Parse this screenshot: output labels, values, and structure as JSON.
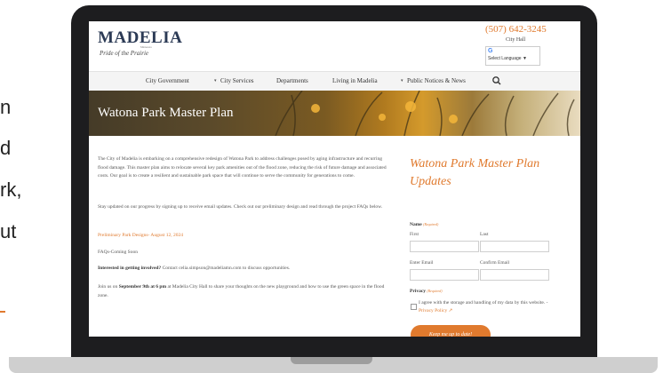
{
  "external_text": {
    "lines": [
      "n",
      "d",
      "rk,",
      "ut"
    ]
  },
  "site": {
    "logo": "MADELIA",
    "logo_sub": "Minnesota",
    "tagline": "Pride of the Prairie",
    "phone": "(507) 642-3245",
    "city_hall": "City Hall",
    "translate_label": "Select Language",
    "translate_caret": "▼",
    "google_g": "G"
  },
  "nav": {
    "items": [
      "City Government",
      "City Services",
      "Departments",
      "Living in Madelia",
      "Public Notices & News"
    ],
    "caret": "▾"
  },
  "hero": {
    "title": "Watona Park Master Plan"
  },
  "content": {
    "intro": "The City of Madelia is embarking on a comprehensive redesign of Watona Park to address challenges posed by aging infrastructure and recurring flood damage. This master plan aims to relocate several key park amenities out of the flood zone, reducing the risk of future damage and associated costs. Our goal is to create a resilient and sustainable park space that will continue to serve the community for generations to come.",
    "stay_updated": "Stay updated on our progress by signing up to receive email updates. Check out our preliminary design and read through the project FAQs below.",
    "prelim_link": "Preliminary Park Designs- August 12, 2024",
    "faqs": "FAQs-Coming Soon",
    "interested_bold": "Interested in getting involved?",
    "interested_rest": " Contact celia.simpson@madeliamn.com to discuss opportunities.",
    "join_pre": "Join us on ",
    "join_bold": "September 9th at 6 pm",
    "join_post": " at Madelia City Hall to share your thoughts on the new playground and how to use the green space in the flood zone."
  },
  "form": {
    "title": "Watona Park Master Plan Updates",
    "name_label": "Name",
    "required": "(Required)",
    "first": "First",
    "last": "Last",
    "enter_email": "Enter Email",
    "confirm_email": "Confirm Email",
    "privacy_label": "Privacy",
    "agree_text": "I agree with the storage and handling of my data by this website. - ",
    "privacy_policy": "Privacy Policy",
    "privacy_ext": "↗",
    "submit": "Keep me up to date!"
  }
}
